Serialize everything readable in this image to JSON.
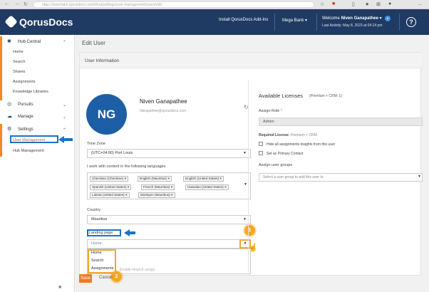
{
  "browser": {
    "url": "https://www.fake.qorusdocs.com/#/hubsettings/user-management/users/edit"
  },
  "header": {
    "logo": "QorusDocs",
    "install": "Install QorusDocs Add-Ins",
    "org": "Mega Bank",
    "welcome": "Welcome",
    "user": "Niven Ganapathee",
    "activity": "Last Activity: May 8, 2023 at 04:14 pm",
    "help": "?"
  },
  "sidebar": {
    "hub_central": "Hub Central",
    "hub_items": [
      "Home",
      "Search",
      "Shares",
      "Assignments",
      "Knowledge Libraries"
    ],
    "pursuits": "Pursuits",
    "manage": "Manage",
    "settings": "Settings",
    "settings_items": [
      "User Management",
      "Hub Management"
    ],
    "collapse": "«"
  },
  "main": {
    "title": "Edit User",
    "section": "User Information",
    "initials": "NG",
    "name": "Niven Ganapathee",
    "email": "hiteapathee@qorusdocs.com",
    "timezone_label": "Time Zone",
    "timezone": "(UTC+04:00) Port Louis",
    "lang_label": "I work with content in the following languages",
    "languages": [
      "Cherokee (Cherokee)",
      "English (Mauritius)",
      "English (United States)",
      "Spanish (United States)",
      "French (Mauritius)",
      "Hawaiian (United States)",
      "Lakota (United States)",
      "Morisyen (Mauritius)"
    ],
    "country_label": "Country",
    "country": "Mauritius",
    "landing_label": "Landing page",
    "landing_value": "Home",
    "landing_options": [
      "Home",
      "Search",
      "Assignments"
    ],
    "obscured": "Enable email & assign",
    "save": "Save",
    "cancel": "Cancel"
  },
  "licenses": {
    "title": "Available Licenses",
    "summary": "(Premium + CRM: 1)",
    "role_label": "Assign Role",
    "role_req": "*",
    "role": "Admin",
    "required_label": "Required License:",
    "required_value": "Premium + CRM",
    "hide_insights": "Hide all assignments insights from this user",
    "primary_contact": "Set as Primary Contact",
    "groups_label": "Assign user groups",
    "groups_placeholder": "Select a user group to add this user to"
  },
  "callouts": [
    "1",
    "2"
  ],
  "colors": {
    "header": "#1f3b63",
    "accent": "#f08a24",
    "highlight_blue": "#1a73c4",
    "callout": "#f5a623",
    "avatar": "#1c5fa6"
  }
}
